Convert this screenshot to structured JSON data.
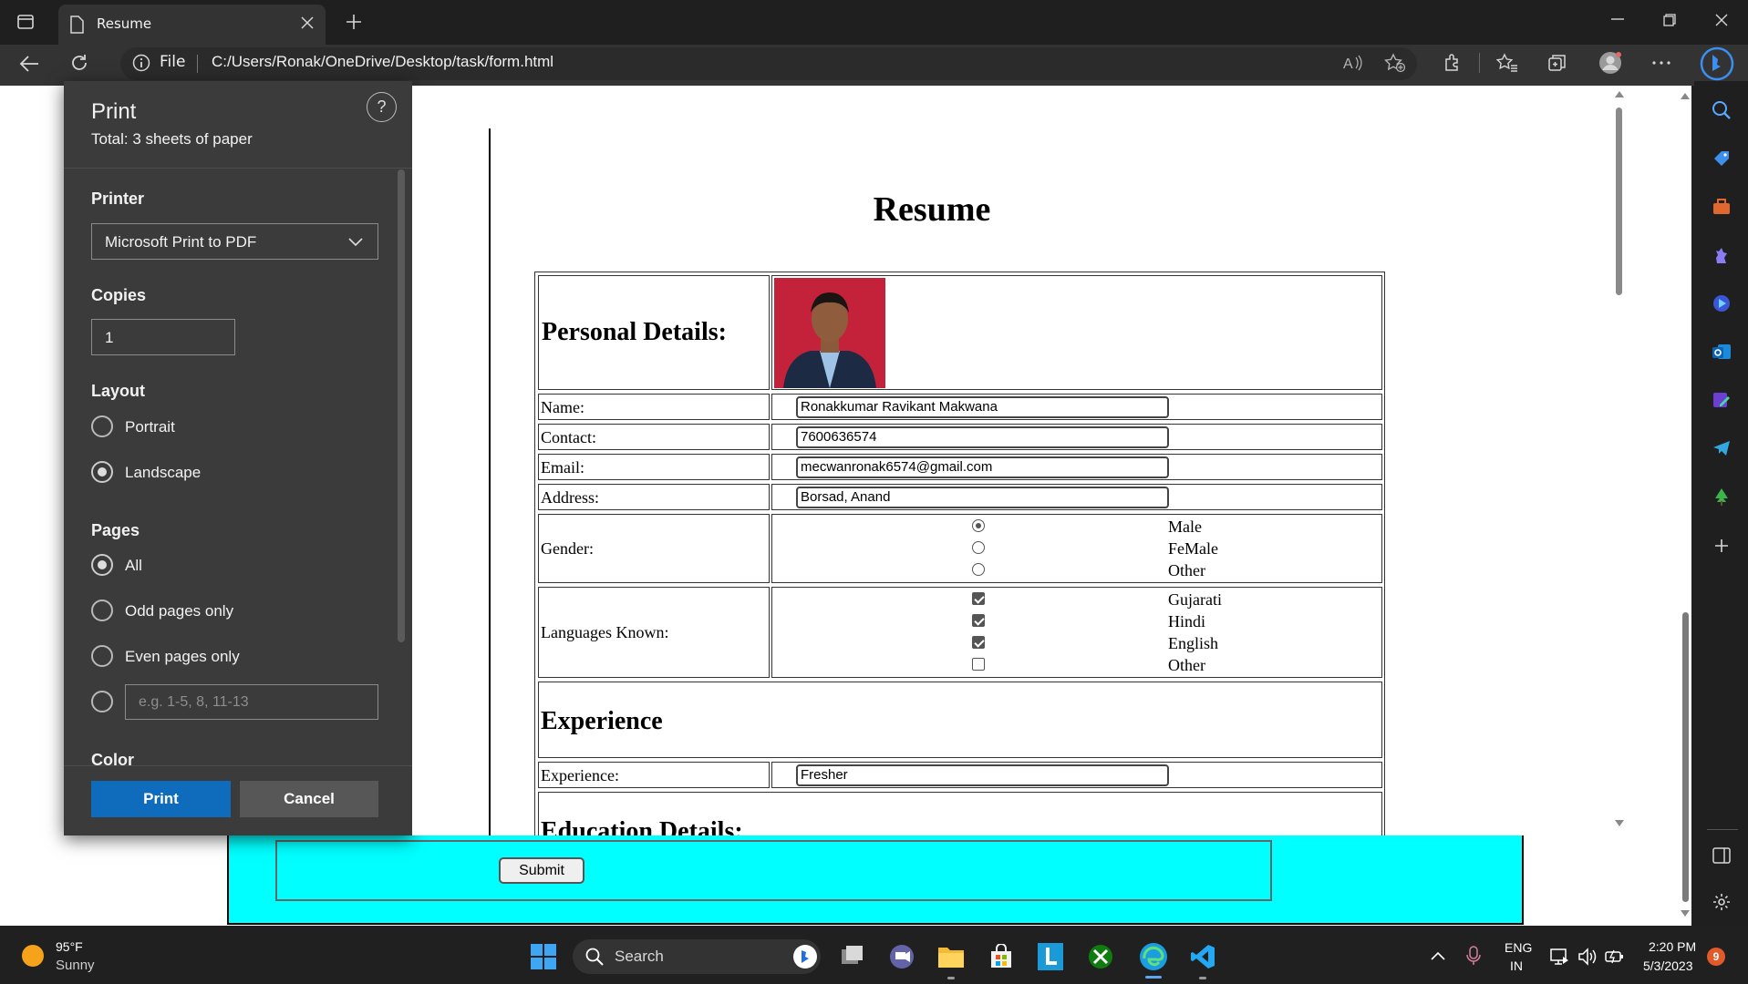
{
  "browser": {
    "tab_title": "Resume",
    "address_scheme": "File",
    "address_url": "C:/Users/Ronak/OneDrive/Desktop/task/form.html"
  },
  "print_dialog": {
    "title": "Print",
    "total": "Total: 3 sheets of paper",
    "help": "?",
    "printer_label": "Printer",
    "printer_value": "Microsoft Print to PDF",
    "copies_label": "Copies",
    "copies_value": "1",
    "layout_label": "Layout",
    "layout_options": [
      "Portrait",
      "Landscape"
    ],
    "layout_selected": "Landscape",
    "pages_label": "Pages",
    "pages_options": [
      "All",
      "Odd pages only",
      "Even pages only"
    ],
    "pages_selected": "All",
    "pages_custom_placeholder": "e.g. 1-5, 8, 11-13",
    "color_label": "Color",
    "print_button": "Print",
    "cancel_button": "Cancel"
  },
  "resume": {
    "heading": "Resume",
    "personal_details": "Personal Details:",
    "rows": [
      {
        "label": "Name:",
        "value": "Ronakkumar Ravikant Makwana"
      },
      {
        "label": "Contact:",
        "value": "7600636574"
      },
      {
        "label": "Email:",
        "value": "mecwanronak6574@gmail.com"
      },
      {
        "label": "Address:",
        "value": "Borsad, Anand"
      }
    ],
    "gender_label": "Gender:",
    "gender_options": [
      "Male",
      "FeMale",
      "Other"
    ],
    "gender_selected": "Male",
    "languages_label": "Languages Known:",
    "languages": [
      {
        "name": "Gujarati",
        "checked": true
      },
      {
        "name": "Hindi",
        "checked": true
      },
      {
        "name": "English",
        "checked": true
      },
      {
        "name": "Other",
        "checked": false
      }
    ],
    "experience_heading": "Experience",
    "experience_label": "Experience:",
    "experience_value": "Fresher",
    "education_heading": "Education Details:"
  },
  "page_behind": {
    "submit_button": "Submit"
  },
  "taskbar": {
    "weather_temp": "95°F",
    "weather_desc": "Sunny",
    "search_label": "Search",
    "lang_top": "ENG",
    "lang_bottom": "IN",
    "time": "2:20 PM",
    "date": "5/3/2023",
    "notification_count": "9"
  },
  "colors": {
    "chrome_bg": "#1f1f1f",
    "panel_bg": "#3b3b3b",
    "accent": "#0f6cbd",
    "cyan": "#00ffff"
  }
}
